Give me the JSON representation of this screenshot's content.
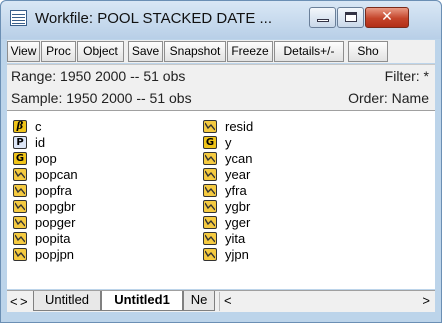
{
  "window": {
    "title": "Workfile: POOL STACKED DATE ...",
    "controls": {
      "minimize": "minimize",
      "maximize": "maximize",
      "close": "✕"
    }
  },
  "toolbar": [
    "View",
    "Proc",
    "Object",
    "Save",
    "Snapshot",
    "Freeze",
    "Details+/-",
    "Sho"
  ],
  "info": {
    "range": "Range:  1950 2000  --  51 obs",
    "filter": "Filter: *",
    "sample": "Sample: 1950 2000  --  51 obs",
    "order": "Order: Name"
  },
  "objects": {
    "left": [
      {
        "name": "c",
        "icon": "coef-icon",
        "glyph": "β"
      },
      {
        "name": "id",
        "icon": "idseries-icon",
        "glyph": "P"
      },
      {
        "name": "pop",
        "icon": "group-icon",
        "glyph": "G"
      },
      {
        "name": "popcan",
        "icon": "series-icon"
      },
      {
        "name": "popfra",
        "icon": "series-icon"
      },
      {
        "name": "popgbr",
        "icon": "series-icon"
      },
      {
        "name": "popger",
        "icon": "series-icon"
      },
      {
        "name": "popita",
        "icon": "series-icon"
      },
      {
        "name": "popjpn",
        "icon": "series-icon"
      }
    ],
    "right": [
      {
        "name": "resid",
        "icon": "series-icon"
      },
      {
        "name": "y",
        "icon": "group-icon",
        "glyph": "G"
      },
      {
        "name": "ycan",
        "icon": "series-icon"
      },
      {
        "name": "year",
        "icon": "series-icon"
      },
      {
        "name": "yfra",
        "icon": "series-icon"
      },
      {
        "name": "ygbr",
        "icon": "series-icon"
      },
      {
        "name": "yger",
        "icon": "series-icon"
      },
      {
        "name": "yita",
        "icon": "series-icon"
      },
      {
        "name": "yjpn",
        "icon": "series-icon"
      }
    ]
  },
  "tabs": {
    "nav_left": "<",
    "nav_right": ">",
    "items": [
      {
        "label": "Untitled",
        "active": false
      },
      {
        "label": "Untitled1",
        "active": true
      },
      {
        "label": "Ne",
        "active": false
      }
    ],
    "scroll_left": "<",
    "scroll_right": ">"
  }
}
